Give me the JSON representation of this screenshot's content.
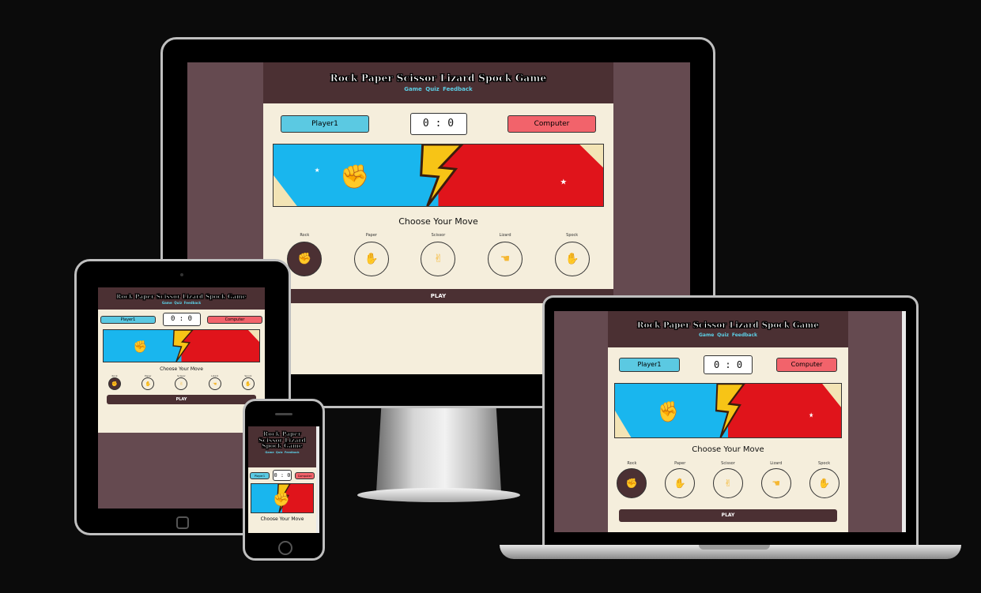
{
  "site": {
    "title": "Rock Paper Scissor Lizard Spock Game",
    "title_phone_lines": [
      "Rock Paper",
      "Scissor Lizard",
      "Spock Game"
    ],
    "nav": [
      "Game",
      "Quiz",
      "Feedback"
    ],
    "player_label": "Player1",
    "computer_label": "Computer",
    "score": "0 : 0",
    "choose_label": "Choose Your Move",
    "moves": [
      {
        "label": "Rock",
        "icon": "rock-fist-icon",
        "glyph": "✊",
        "active": true
      },
      {
        "label": "Paper",
        "icon": "paper-hand-icon",
        "glyph": "✋",
        "active": false
      },
      {
        "label": "Scissor",
        "icon": "scissor-hand-icon",
        "glyph": "✌",
        "active": false
      },
      {
        "label": "Lizard",
        "icon": "lizard-hand-icon",
        "glyph": "☚",
        "active": false
      },
      {
        "label": "Spock",
        "icon": "spock-hand-icon",
        "glyph": "✋",
        "active": false
      }
    ],
    "play_label": "PLAY"
  },
  "colors": {
    "page_bg": "#654a50",
    "content_bg": "#f5eedc",
    "header_bg": "#4b3033",
    "nav_link": "#5ccfe6",
    "player_bg": "#5bc9e2",
    "computer_bg": "#f2636b",
    "banner_blue": "#19b6ee",
    "banner_red": "#e0141b",
    "bolt_yellow": "#f7c416"
  }
}
